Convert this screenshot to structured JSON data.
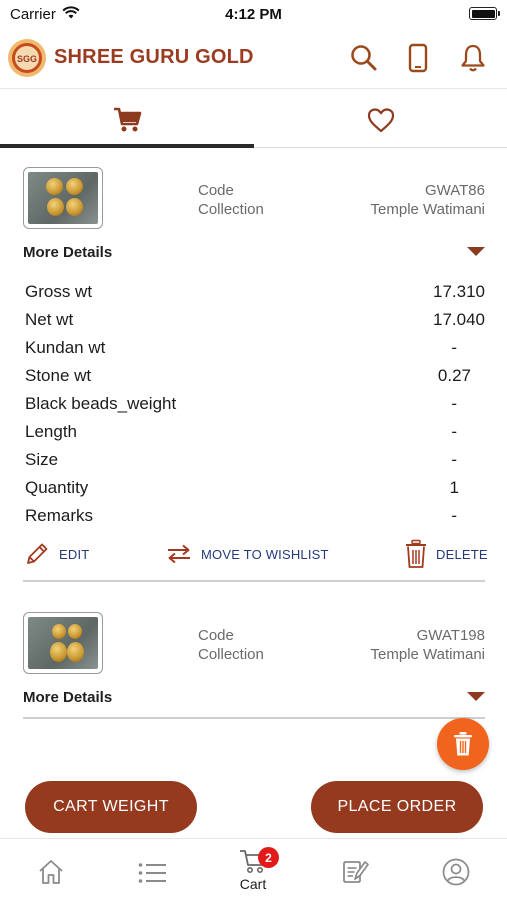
{
  "status_bar": {
    "carrier": "Carrier",
    "time": "4:12 PM"
  },
  "header": {
    "logo_text": "SGG",
    "brand": "SHREE GURU GOLD",
    "icons": [
      "search-icon",
      "phone-icon",
      "bell-icon"
    ]
  },
  "tabs": [
    {
      "icon": "cart-icon",
      "active": true
    },
    {
      "icon": "heart-icon",
      "active": false
    }
  ],
  "cart_items": [
    {
      "code_label": "Code",
      "code": "GWAT86",
      "collection_label": "Collection",
      "collection": "Temple Watimani",
      "more_details": "More Details",
      "details": [
        {
          "label": "Gross wt",
          "value": "17.310"
        },
        {
          "label": "Net wt",
          "value": "17.040"
        },
        {
          "label": "Kundan wt",
          "value": "-"
        },
        {
          "label": "Stone wt",
          "value": "0.27"
        },
        {
          "label": "Black beads_weight",
          "value": "-"
        },
        {
          "label": "Length",
          "value": "-"
        },
        {
          "label": "Size",
          "value": "-"
        },
        {
          "label": "Quantity",
          "value": "1"
        },
        {
          "label": "Remarks",
          "value": "-"
        }
      ],
      "actions": {
        "edit": "EDIT",
        "move": "MOVE TO WISHLIST",
        "delete": "DELETE"
      }
    },
    {
      "code_label": "Code",
      "code": "GWAT198",
      "collection_label": "Collection",
      "collection": "Temple Watimani",
      "more_details": "More Details"
    }
  ],
  "buttons": {
    "cart_weight": "CART WEIGHT",
    "place_order": "PLACE ORDER"
  },
  "bottom_nav": [
    {
      "icon": "home-icon",
      "label": ""
    },
    {
      "icon": "list-icon",
      "label": ""
    },
    {
      "icon": "cart-icon",
      "label": "Cart",
      "badge": "2"
    },
    {
      "icon": "catalog-icon",
      "label": ""
    },
    {
      "icon": "profile-icon",
      "label": ""
    }
  ],
  "colors": {
    "brand": "#9b3b20",
    "button": "#953a1e",
    "fab": "#f0641e",
    "action_text": "#263a7a",
    "badge": "#e21a1a"
  }
}
